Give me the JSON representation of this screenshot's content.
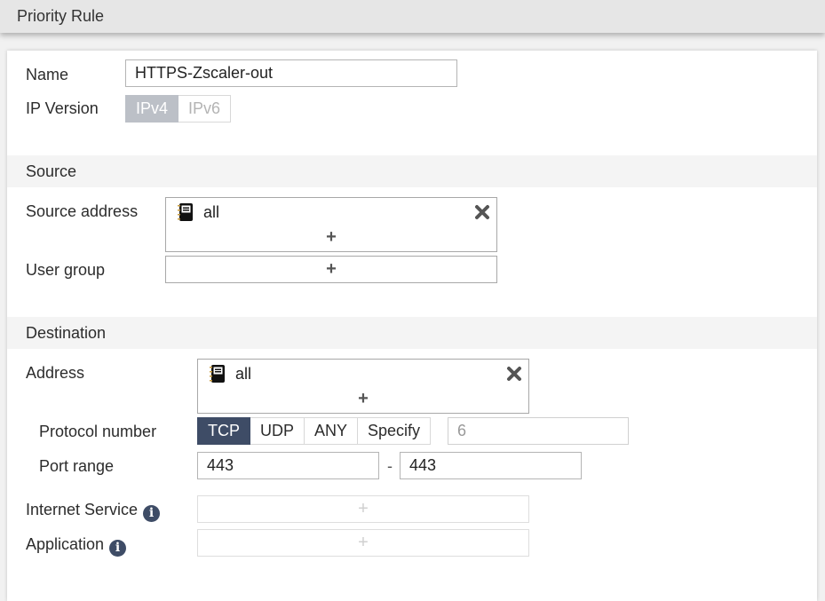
{
  "window": {
    "title": "Priority Rule"
  },
  "form": {
    "name": {
      "label": "Name",
      "value": "HTTPS-Zscaler-out"
    },
    "ip_version": {
      "label": "IP Version",
      "options": [
        "IPv4",
        "IPv6"
      ],
      "selected": "IPv4"
    }
  },
  "source": {
    "header": "Source",
    "address": {
      "label": "Source address",
      "entries": [
        "all"
      ],
      "add": "+",
      "icon": "address-book-icon"
    },
    "user_group": {
      "label": "User group",
      "add": "+"
    }
  },
  "destination": {
    "header": "Destination",
    "address": {
      "label": "Address",
      "entries": [
        "all"
      ],
      "add": "+",
      "icon": "address-book-icon"
    },
    "protocol": {
      "label": "Protocol number",
      "options": [
        "TCP",
        "UDP",
        "ANY",
        "Specify"
      ],
      "selected": "TCP",
      "value": "6"
    },
    "port_range": {
      "label": "Port range",
      "from": "443",
      "separator": "-",
      "to": "443"
    },
    "internet_service": {
      "label": "Internet Service",
      "add": "+",
      "info": "i"
    },
    "application": {
      "label": "Application",
      "add": "+",
      "info": "i"
    }
  },
  "colors": {
    "accent": "#3e4c66",
    "ipv4_selected": "#bcc0c7",
    "section_bg": "#f4f4f4",
    "titlebar_bg": "#e6e6e6"
  }
}
